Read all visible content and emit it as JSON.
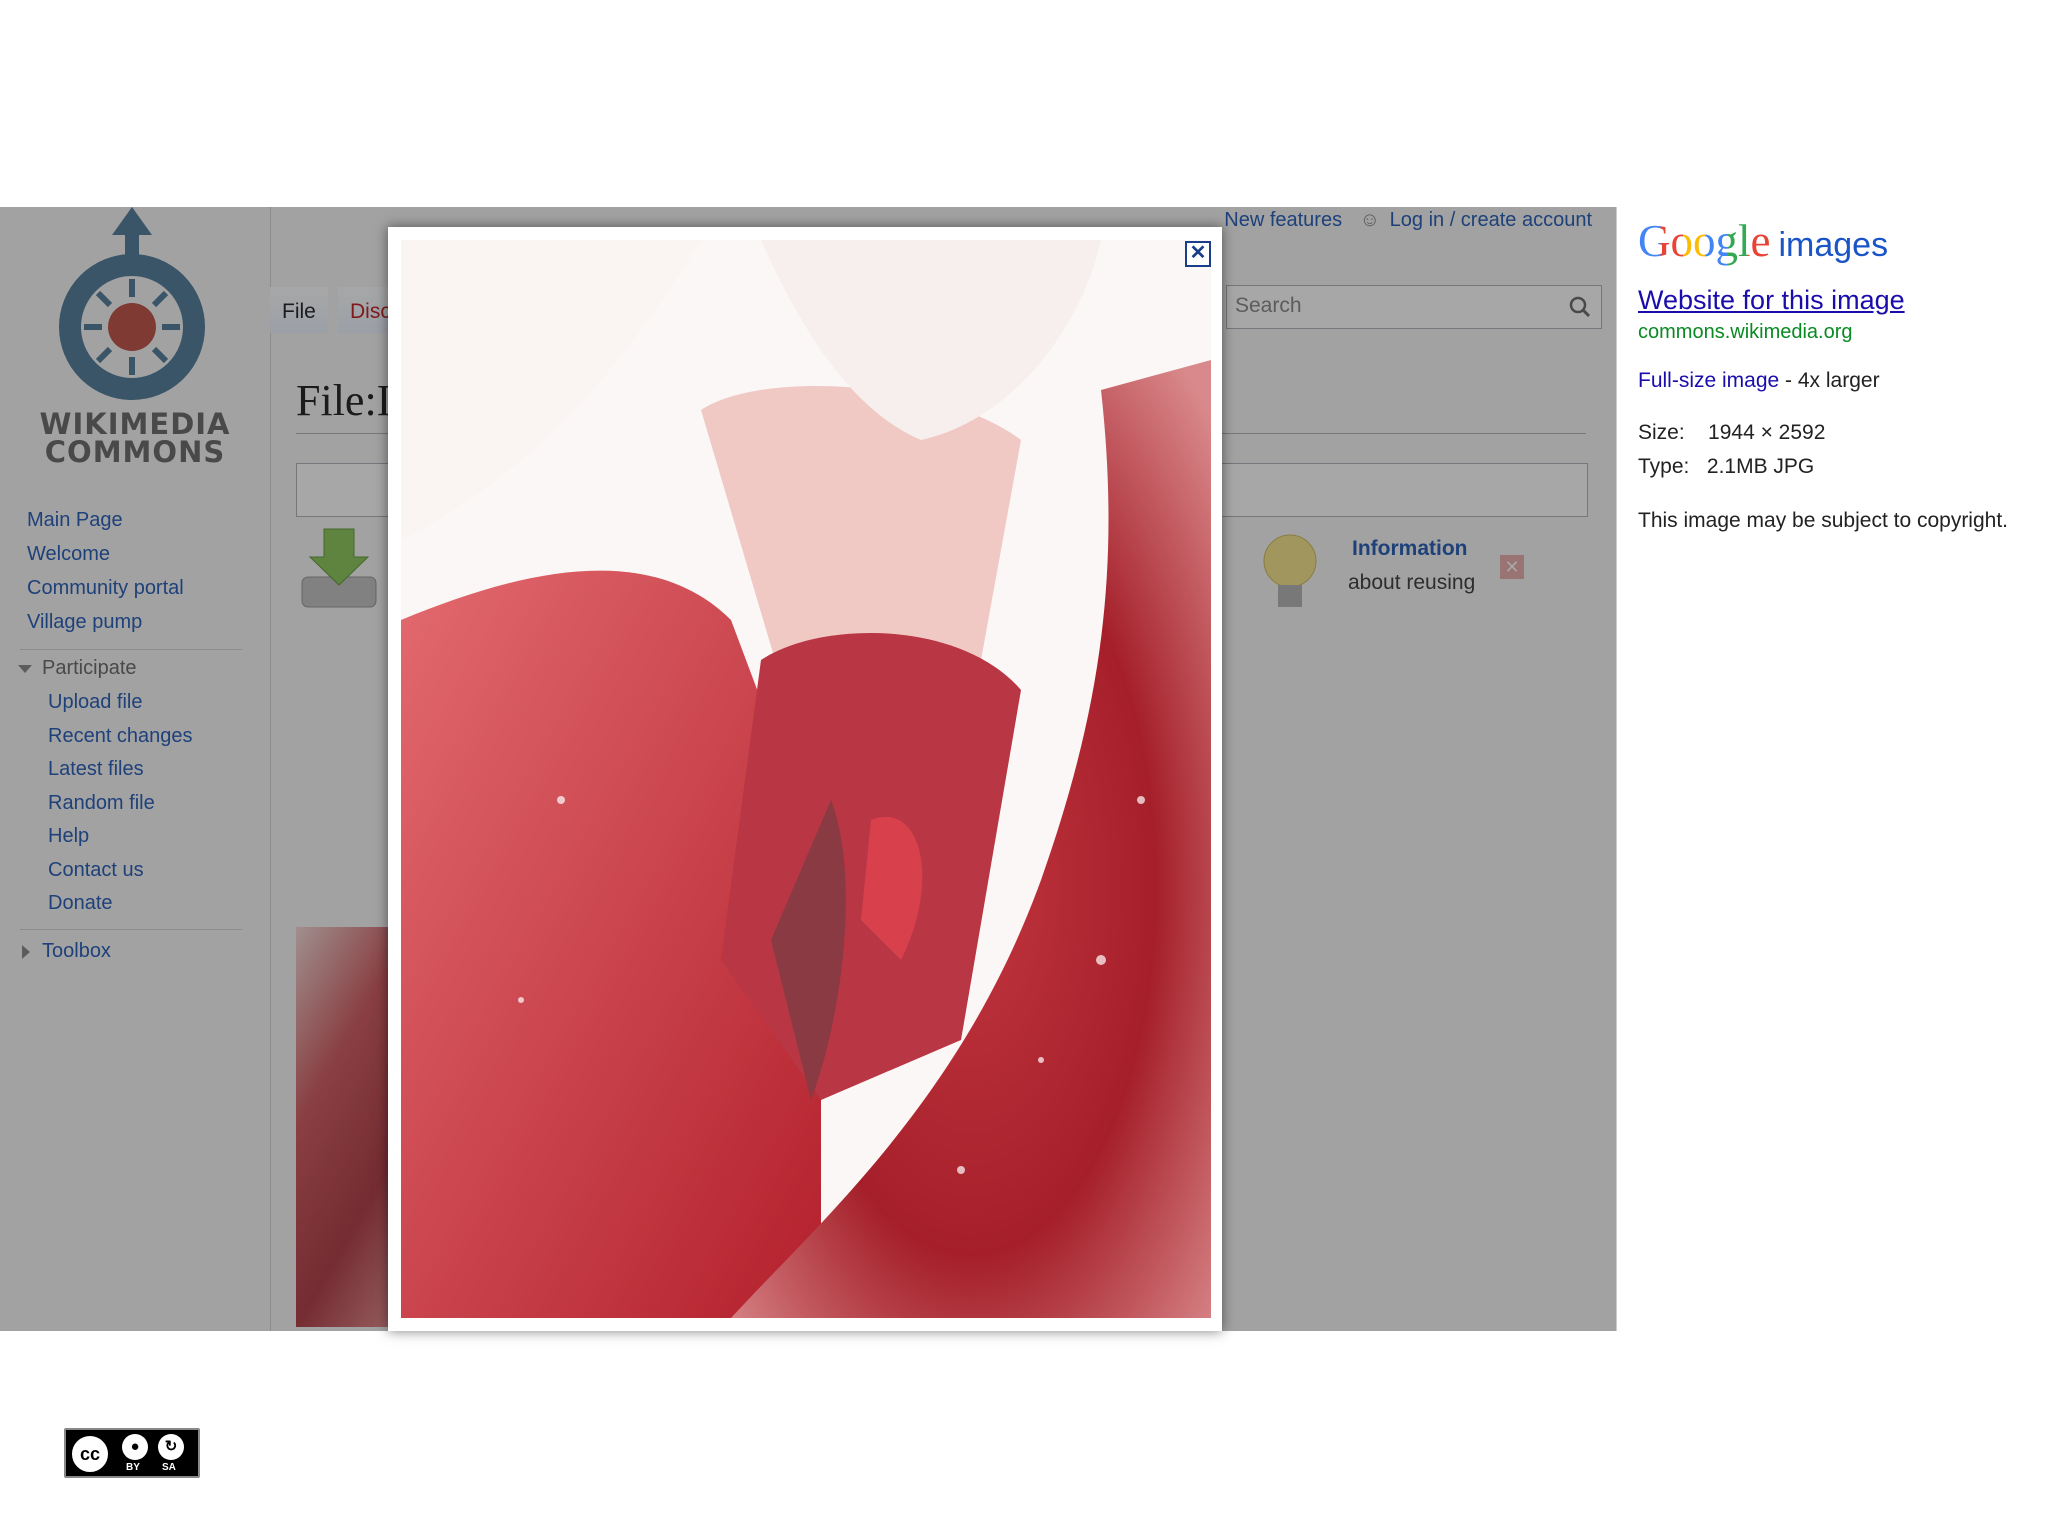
{
  "wikimedia": {
    "logo_line1": "WIKIMEDIA",
    "logo_line2": "COMMONS",
    "nav": {
      "main_page": "Main Page",
      "welcome": "Welcome",
      "community_portal": "Community portal",
      "village_pump": "Village pump",
      "participate": "Participate",
      "upload_file": "Upload file",
      "recent_changes": "Recent changes",
      "latest_files": "Latest files",
      "random_file": "Random file",
      "help": "Help",
      "contact_us": "Contact us",
      "donate": "Donate",
      "toolbox": "Toolbox"
    },
    "tabs": {
      "file": "File",
      "discussion": "Discu"
    },
    "page_title": "File:I",
    "top_links": {
      "new_features": "New features",
      "login": "Log in / create account"
    },
    "search_placeholder": "Search",
    "info_title": "Information",
    "info_sub": "about reusing"
  },
  "lightbox": {
    "close_label": "✕"
  },
  "google": {
    "logo_text": "Google",
    "logo_sub": "images",
    "website_link": "Website for this image",
    "domain": "commons.wikimedia.org",
    "full_size_link": "Full-size image",
    "full_size_suffix": " - 4x larger",
    "size_label": "Size:",
    "size_value": "1944 × 2592",
    "type_label": "Type:",
    "type_value": "2.1MB JPG",
    "copyright": "This image may be subject to copyright."
  },
  "cc_badge": {
    "cc": "cc",
    "by": "BY",
    "sa": "SA"
  },
  "colors": {
    "google_blue": "#4285f4",
    "google_red": "#ea4335",
    "google_yellow": "#fbbc05",
    "google_green": "#34a853"
  }
}
